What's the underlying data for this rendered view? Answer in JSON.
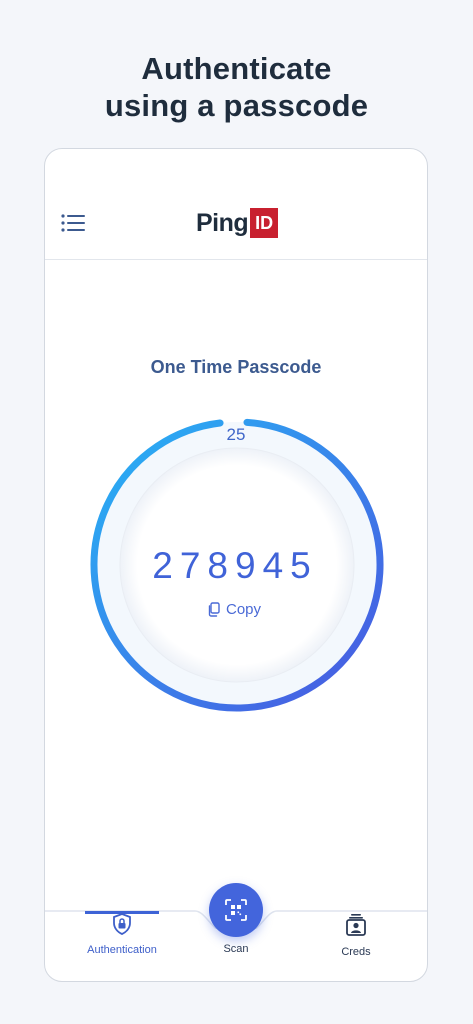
{
  "headline": {
    "line1": "Authenticate",
    "line2": "using a passcode"
  },
  "appbar": {
    "logo_text": "Ping",
    "logo_badge": "ID",
    "menu_icon": "hamburger-list-icon"
  },
  "otp": {
    "title": "One Time Passcode",
    "countdown": "25",
    "code": "278945",
    "copy_label": "Copy",
    "copy_icon": "copy-icon",
    "progress_fraction": 0.97
  },
  "tabs": [
    {
      "label": "Authentication",
      "icon": "shield-lock-icon",
      "active": true
    },
    {
      "label": "Scan",
      "icon": "qr-scan-icon",
      "active": false
    },
    {
      "label": "Creds",
      "icon": "id-card-icon",
      "active": false
    }
  ],
  "colors": {
    "accent": "#4365dc",
    "gradient_start": "#27b4f5",
    "gradient_end": "#4a56e0",
    "logo_red": "#c8202f",
    "title": "#3c5a8f"
  }
}
